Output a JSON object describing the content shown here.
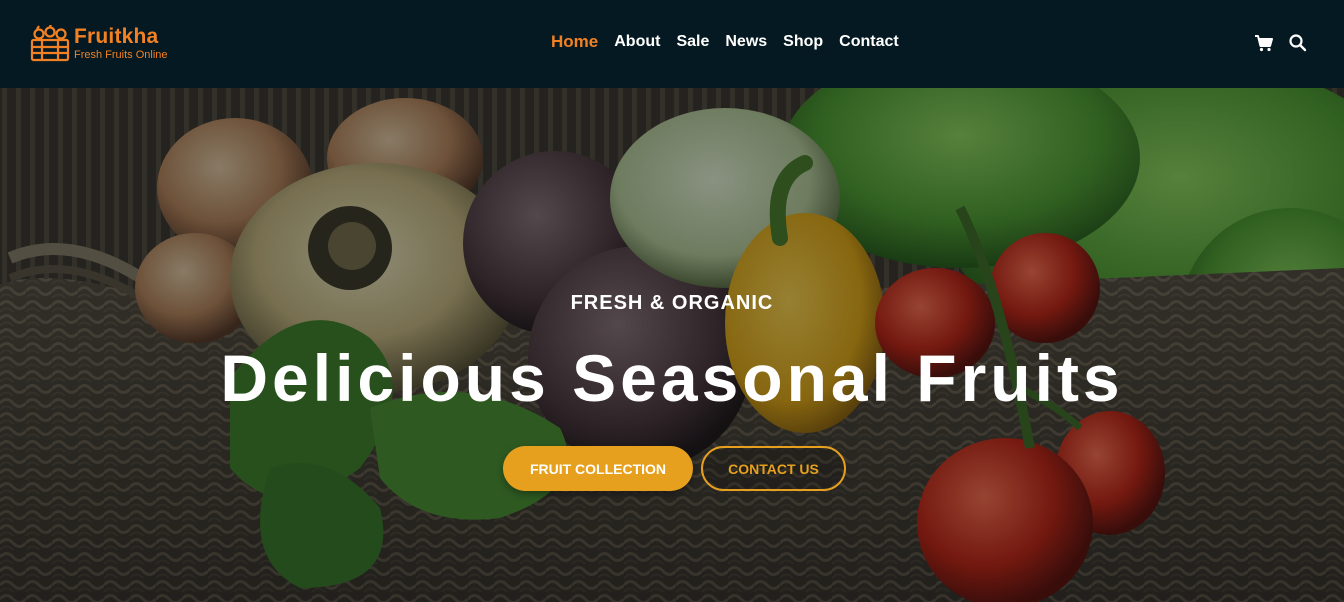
{
  "brand": {
    "name": "Fruitkha",
    "tagline": "Fresh Fruits Online"
  },
  "nav": {
    "home": "Home",
    "about": "About",
    "sale": "Sale",
    "news": "News",
    "shop": "Shop",
    "contact": "Contact"
  },
  "header_icons": [
    "cart-icon",
    "search-icon"
  ],
  "hero": {
    "subtitle": "FRESH & ORGANIC",
    "title": "Delicious Seasonal Fruits",
    "primary_button": "FRUIT COLLECTION",
    "secondary_button": "CONTACT US"
  },
  "colors": {
    "header_bg": "#051922",
    "brand_orange": "#F28123",
    "button_gold": "#E6A01E",
    "text_white": "#ffffff"
  }
}
